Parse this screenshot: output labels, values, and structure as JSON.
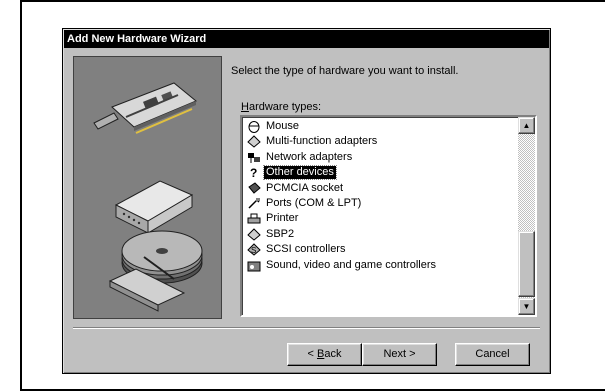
{
  "window": {
    "title": "Add New Hardware Wizard"
  },
  "instruction": "Select the type of hardware you want to install.",
  "list": {
    "label_prefix": "",
    "label_access": "H",
    "label_rest": "ardware types:",
    "items": [
      {
        "label": "Mouse",
        "icon": "mouse-icon"
      },
      {
        "label": "Multi-function adapters",
        "icon": "multifunction-adapter-icon"
      },
      {
        "label": "Network adapters",
        "icon": "network-adapter-icon"
      },
      {
        "label": "Other devices",
        "icon": "other-devices-icon",
        "selected": true
      },
      {
        "label": "PCMCIA socket",
        "icon": "pcmcia-socket-icon"
      },
      {
        "label": "Ports (COM & LPT)",
        "icon": "ports-icon"
      },
      {
        "label": "Printer",
        "icon": "printer-icon"
      },
      {
        "label": "SBP2",
        "icon": "sbp2-icon"
      },
      {
        "label": "SCSI controllers",
        "icon": "scsi-controller-icon"
      },
      {
        "label": "Sound, video and game controllers",
        "icon": "sound-video-game-icon"
      }
    ]
  },
  "buttons": {
    "back_prefix": "< ",
    "back_access": "B",
    "back_rest": "ack",
    "next": "Next >",
    "cancel": "Cancel"
  },
  "colors": {
    "dialog_bg": "#c0c0c0",
    "titlebar_bg": "#000000",
    "art_panel_bg": "#808080",
    "selection_bg": "#000000"
  }
}
